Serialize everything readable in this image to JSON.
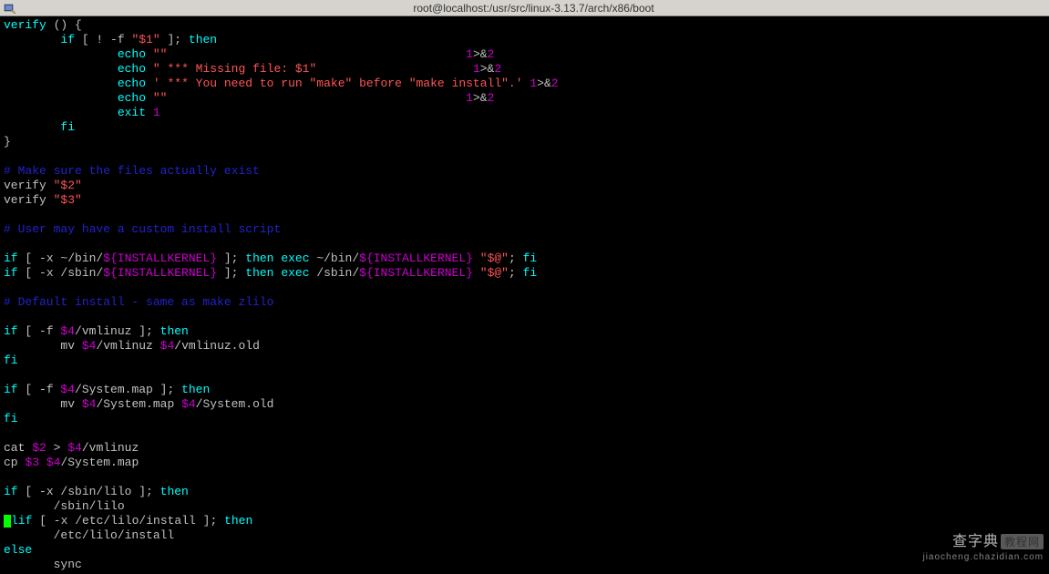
{
  "titlebar": {
    "title": "root@localhost:/usr/src/linux-3.13.7/arch/x86/boot"
  },
  "code": {
    "lines": [
      [
        [
          "cyan",
          "verify"
        ],
        [
          "gray",
          " () {"
        ]
      ],
      [
        [
          "gray",
          "        "
        ],
        [
          "cyan",
          "if"
        ],
        [
          "gray",
          " [ ! -f "
        ],
        [
          "redb",
          "\"$1\""
        ],
        [
          "gray",
          " ]; "
        ],
        [
          "cyan",
          "then"
        ]
      ],
      [
        [
          "gray",
          "                "
        ],
        [
          "cyan",
          "echo"
        ],
        [
          "gray",
          " "
        ],
        [
          "redb",
          "\"\""
        ],
        [
          "gray",
          "                                          "
        ],
        [
          "mag",
          "1"
        ],
        [
          "gray",
          ">&"
        ],
        [
          "mag",
          "2"
        ]
      ],
      [
        [
          "gray",
          "                "
        ],
        [
          "cyan",
          "echo"
        ],
        [
          "gray",
          " "
        ],
        [
          "redb",
          "\" *** Missing file: $1\""
        ],
        [
          "gray",
          "                      "
        ],
        [
          "mag",
          "1"
        ],
        [
          "gray",
          ">&"
        ],
        [
          "mag",
          "2"
        ]
      ],
      [
        [
          "gray",
          "                "
        ],
        [
          "cyan",
          "echo"
        ],
        [
          "gray",
          " "
        ],
        [
          "redb",
          "' *** You need to run \"make\" before \"make install\".'"
        ],
        [
          "gray",
          " "
        ],
        [
          "mag",
          "1"
        ],
        [
          "gray",
          ">&"
        ],
        [
          "mag",
          "2"
        ]
      ],
      [
        [
          "gray",
          "                "
        ],
        [
          "cyan",
          "echo"
        ],
        [
          "gray",
          " "
        ],
        [
          "redb",
          "\"\""
        ],
        [
          "gray",
          "                                          "
        ],
        [
          "mag",
          "1"
        ],
        [
          "gray",
          ">&"
        ],
        [
          "mag",
          "2"
        ]
      ],
      [
        [
          "gray",
          "                "
        ],
        [
          "cyan",
          "exit"
        ],
        [
          "gray",
          " "
        ],
        [
          "mag",
          "1"
        ]
      ],
      [
        [
          "gray",
          "        "
        ],
        [
          "cyan",
          "fi"
        ]
      ],
      [
        [
          "gray",
          "}"
        ]
      ],
      [],
      [
        [
          "blue",
          "# Make sure the files actually exist"
        ]
      ],
      [
        [
          "gray",
          "verify "
        ],
        [
          "redb",
          "\"$2\""
        ]
      ],
      [
        [
          "gray",
          "verify "
        ],
        [
          "redb",
          "\"$3\""
        ]
      ],
      [],
      [
        [
          "blue",
          "# User may have a custom install script"
        ]
      ],
      [],
      [
        [
          "cyan",
          "if"
        ],
        [
          "gray",
          " [ -x ~/bin/"
        ],
        [
          "mag",
          "${INSTALLKERNEL}"
        ],
        [
          "gray",
          " ]; "
        ],
        [
          "cyan",
          "then"
        ],
        [
          "gray",
          " "
        ],
        [
          "cyan",
          "exec"
        ],
        [
          "gray",
          " ~/bin/"
        ],
        [
          "mag",
          "${INSTALLKERNEL}"
        ],
        [
          "gray",
          " "
        ],
        [
          "redb",
          "\"$@\""
        ],
        [
          "gray",
          "; "
        ],
        [
          "cyan",
          "fi"
        ]
      ],
      [
        [
          "cyan",
          "if"
        ],
        [
          "gray",
          " [ -x /sbin/"
        ],
        [
          "mag",
          "${INSTALLKERNEL}"
        ],
        [
          "gray",
          " ]; "
        ],
        [
          "cyan",
          "then"
        ],
        [
          "gray",
          " "
        ],
        [
          "cyan",
          "exec"
        ],
        [
          "gray",
          " /sbin/"
        ],
        [
          "mag",
          "${INSTALLKERNEL}"
        ],
        [
          "gray",
          " "
        ],
        [
          "redb",
          "\"$@\""
        ],
        [
          "gray",
          "; "
        ],
        [
          "cyan",
          "fi"
        ]
      ],
      [],
      [
        [
          "blue",
          "# Default install - same as make zlilo"
        ]
      ],
      [],
      [
        [
          "cyan",
          "if"
        ],
        [
          "gray",
          " [ -f "
        ],
        [
          "mag",
          "$4"
        ],
        [
          "gray",
          "/vmlinuz ]; "
        ],
        [
          "cyan",
          "then"
        ]
      ],
      [
        [
          "gray",
          "        mv "
        ],
        [
          "mag",
          "$4"
        ],
        [
          "gray",
          "/vmlinuz "
        ],
        [
          "mag",
          "$4"
        ],
        [
          "gray",
          "/vmlinuz.old"
        ]
      ],
      [
        [
          "cyan",
          "fi"
        ]
      ],
      [],
      [
        [
          "cyan",
          "if"
        ],
        [
          "gray",
          " [ -f "
        ],
        [
          "mag",
          "$4"
        ],
        [
          "gray",
          "/System.map ]; "
        ],
        [
          "cyan",
          "then"
        ]
      ],
      [
        [
          "gray",
          "        mv "
        ],
        [
          "mag",
          "$4"
        ],
        [
          "gray",
          "/System.map "
        ],
        [
          "mag",
          "$4"
        ],
        [
          "gray",
          "/System.old"
        ]
      ],
      [
        [
          "cyan",
          "fi"
        ]
      ],
      [],
      [
        [
          "gray",
          "cat "
        ],
        [
          "mag",
          "$2"
        ],
        [
          "gray",
          " > "
        ],
        [
          "mag",
          "$4"
        ],
        [
          "gray",
          "/vmlinuz"
        ]
      ],
      [
        [
          "gray",
          "cp "
        ],
        [
          "mag",
          "$3"
        ],
        [
          "gray",
          " "
        ],
        [
          "mag",
          "$4"
        ],
        [
          "gray",
          "/System.map"
        ]
      ],
      [],
      [
        [
          "cyan",
          "if"
        ],
        [
          "gray",
          " [ -x /sbin/lilo ]; "
        ],
        [
          "cyan",
          "then"
        ]
      ],
      [
        [
          "gray",
          "       /sbin/lilo"
        ]
      ],
      [
        [
          "cursor",
          ""
        ],
        [
          "cyan",
          "lif"
        ],
        [
          "gray",
          " [ -x /etc/lilo/install ]; "
        ],
        [
          "cyan",
          "then"
        ]
      ],
      [
        [
          "gray",
          "       /etc/lilo/install"
        ]
      ],
      [
        [
          "cyan",
          "else"
        ]
      ],
      [
        [
          "gray",
          "       sync"
        ]
      ]
    ]
  },
  "watermark": {
    "main": "查字典",
    "box": "教程网",
    "sub": "jiaocheng.chazidian.com"
  }
}
